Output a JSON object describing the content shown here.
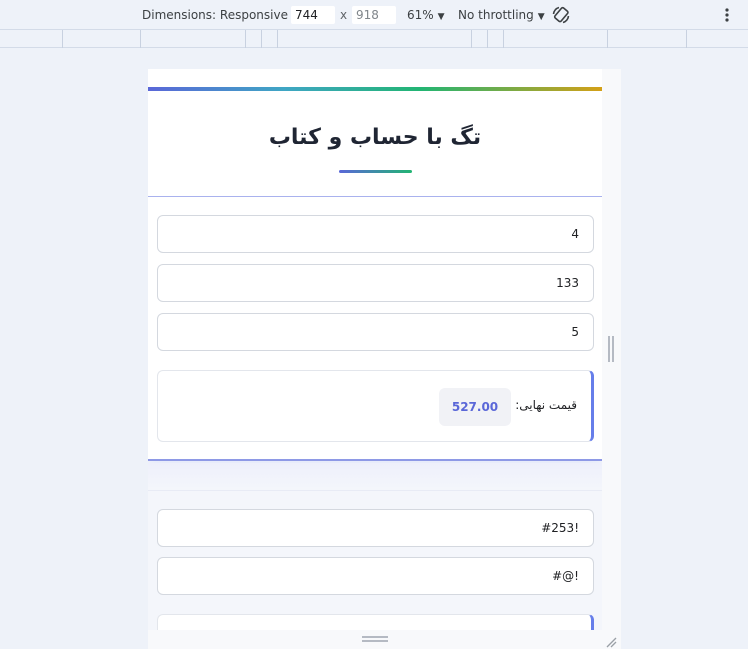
{
  "toolbar": {
    "dimensions_label": "Dimensions: Responsive",
    "width_value": "744",
    "x_separator": "x",
    "height_placeholder": "918",
    "zoom_label": "61%",
    "throttling_label": "No throttling",
    "rotate_icon": "rotate-icon",
    "more_icon": "more-vert-icon"
  },
  "page": {
    "title": "تگ با حساب و کتاب",
    "fields": [
      "4",
      "133",
      "5"
    ],
    "result": {
      "label": "قیمت نهایی:",
      "value": "527.00"
    },
    "second_fields": [
      "!#253",
      "!@#"
    ]
  },
  "colors": {
    "accent": "#5a67d8",
    "accent_green": "#22b573",
    "accent_gold": "#d4a017",
    "devtools_bg": "#eef2f9"
  }
}
